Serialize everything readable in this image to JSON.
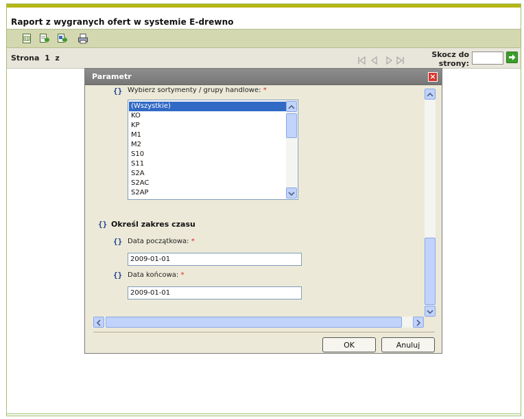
{
  "report": {
    "title": "Raport z wygranych ofert w systemie E-drewno"
  },
  "toolbar": {
    "icons": [
      "export-icon",
      "export-next-icon",
      "export-all-icon",
      "print-icon"
    ]
  },
  "nav": {
    "page_label": "Strona  1  z",
    "jump_label": "Skocz do strony:",
    "jump_value": ""
  },
  "dialog": {
    "title": "Parametr",
    "sortiment_label": "Wybierz sortymenty / grupy handlowe:",
    "required_mark": "*",
    "sortiment_options": [
      "(Wszystkie)",
      "KO",
      "KP",
      "M1",
      "M2",
      "S10",
      "S11",
      "S2A",
      "S2AC",
      "S2AP"
    ],
    "selected_option": "(Wszystkie)",
    "section_title": "Określ zakres czasu",
    "start_label": "Data początkowa:",
    "start_value": "2009-01-01",
    "end_label": "Data końcowa:",
    "end_value": "2009-01-01",
    "ok_label": "OK",
    "cancel_label": "Anuluj"
  },
  "colors": {
    "accent_bar": "#b7b516",
    "toolbar_bg": "#d4d8b0",
    "selection": "#316ac5",
    "close_red": "#d9352b"
  }
}
